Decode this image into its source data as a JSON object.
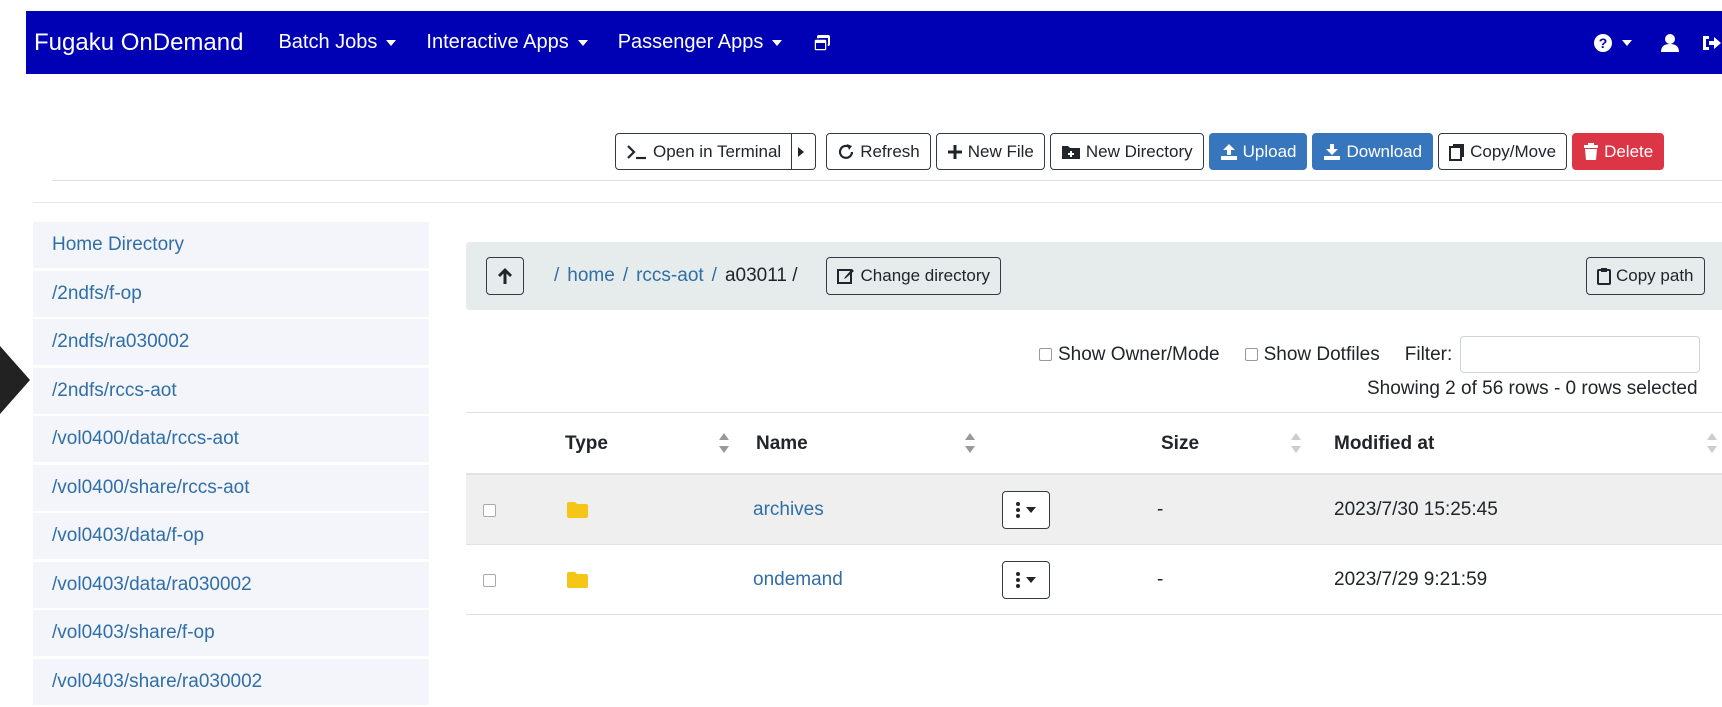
{
  "navbar": {
    "brand": "Fugaku OnDemand",
    "menus": [
      {
        "label": "Batch Jobs"
      },
      {
        "label": "Interactive Apps"
      },
      {
        "label": "Passenger Apps"
      }
    ],
    "icons": [
      "copy-windows-icon",
      "help-icon",
      "user-icon",
      "logout-icon"
    ]
  },
  "toolbar": {
    "open_terminal": "Open in Terminal",
    "refresh": "Refresh",
    "new_file": "New File",
    "new_directory": "New Directory",
    "upload": "Upload",
    "download": "Download",
    "copy_move": "Copy/Move",
    "delete": "Delete"
  },
  "sidebar": {
    "items": [
      {
        "label": "Home Directory"
      },
      {
        "label": "/2ndfs/f-op"
      },
      {
        "label": "/2ndfs/ra030002"
      },
      {
        "label": "/2ndfs/rccs-aot"
      },
      {
        "label": "/vol0400/data/rccs-aot"
      },
      {
        "label": "/vol0400/share/rccs-aot"
      },
      {
        "label": "/vol0403/data/f-op"
      },
      {
        "label": "/vol0403/data/ra030002"
      },
      {
        "label": "/vol0403/share/f-op"
      },
      {
        "label": "/vol0403/share/ra030002"
      }
    ]
  },
  "breadcrumb": {
    "sep": "/",
    "parts": [
      "home",
      "rccs-aot"
    ],
    "current": "a03011 /",
    "change_directory": "Change directory",
    "copy_path": "Copy path"
  },
  "options": {
    "show_owner_mode": "Show Owner/Mode",
    "show_dotfiles": "Show Dotfiles",
    "filter_label": "Filter:",
    "filter_value": "",
    "showing": "Showing 2 of 56 rows - 0 rows selected"
  },
  "table": {
    "headers": {
      "type": "Type",
      "name": "Name",
      "size": "Size",
      "modified": "Modified at"
    },
    "rows": [
      {
        "name": "archives",
        "size": "-",
        "modified": "2023/7/30 15:25:45"
      },
      {
        "name": "ondemand",
        "size": "-",
        "modified": "2023/7/29 9:21:59"
      }
    ]
  },
  "colors": {
    "navbar": "#0000b4",
    "primary": "#3776bd",
    "danger": "#dc3545",
    "link": "#2f6fa6",
    "folder": "#f5c518"
  }
}
